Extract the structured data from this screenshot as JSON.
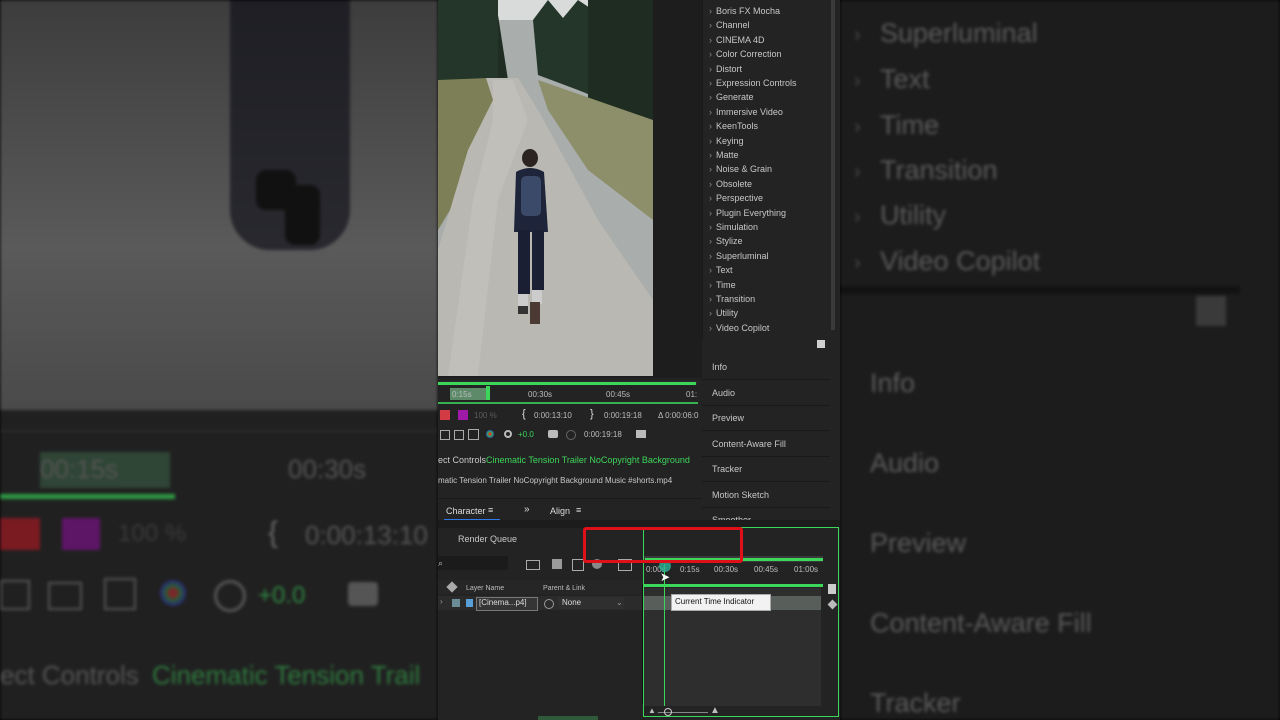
{
  "background_left": {
    "time_left": "00:15s",
    "time_right": "00:30s",
    "percent": "100 %",
    "timecode": "0:00:13:10",
    "plus_value": "+0.0",
    "effect_controls_prefix": "ect Controls",
    "effect_controls_comp": "Cinematic Tension Trail"
  },
  "background_right": {
    "items": [
      "Superluminal",
      "Text",
      "Time",
      "Transition",
      "Utility",
      "Video Copilot"
    ],
    "panels": [
      "Info",
      "Audio",
      "Preview",
      "Content-Aware Fill",
      "Tracker"
    ]
  },
  "effects_list": {
    "items": [
      "Boris FX Mocha",
      "Channel",
      "CINEMA 4D",
      "Color Correction",
      "Distort",
      "Expression Controls",
      "Generate",
      "Immersive Video",
      "KeenTools",
      "Keying",
      "Matte",
      "Noise & Grain",
      "Obsolete",
      "Perspective",
      "Plugin Everything",
      "Simulation",
      "Stylize",
      "Superluminal",
      "Text",
      "Time",
      "Transition",
      "Utility",
      "Video Copilot"
    ]
  },
  "side_panels": [
    "Info",
    "Audio",
    "Preview",
    "Content-Aware Fill",
    "Tracker",
    "Motion Sketch",
    "Smoother"
  ],
  "preview_timeline": {
    "ticks": [
      "0:15s",
      "00:30s",
      "00:45s",
      "01:"
    ],
    "percent": "100 %",
    "current_time": "0:00:13:10",
    "end_time": "0:00:19:18",
    "delta": "Δ 0:00:06:0",
    "plus_value": "+0.0",
    "timecode2": "0:00:19:18"
  },
  "effect_controls": {
    "label": "ect Controls",
    "comp_name": "Cinematic Tension Trailer NoCopyright Background",
    "file_name": "matic Tension Trailer NoCopyright Background Music #shorts.mp4"
  },
  "tabs": {
    "character": "Character",
    "align": "Align",
    "render_queue": "Render Queue"
  },
  "timeline": {
    "ticks": [
      "0:00s",
      "0:15s",
      "00:30s",
      "00:45s",
      "01:00s"
    ],
    "col_layer_name": "Layer Name",
    "col_parent": "Parent & Link",
    "layer_name": "[Cinema...p4]",
    "parent_value": "None",
    "tooltip": "Current Time Indicator"
  },
  "colors": {
    "accent_green": "#3cd65a",
    "highlight_red": "#e0101a",
    "panel_bg": "#232323"
  }
}
